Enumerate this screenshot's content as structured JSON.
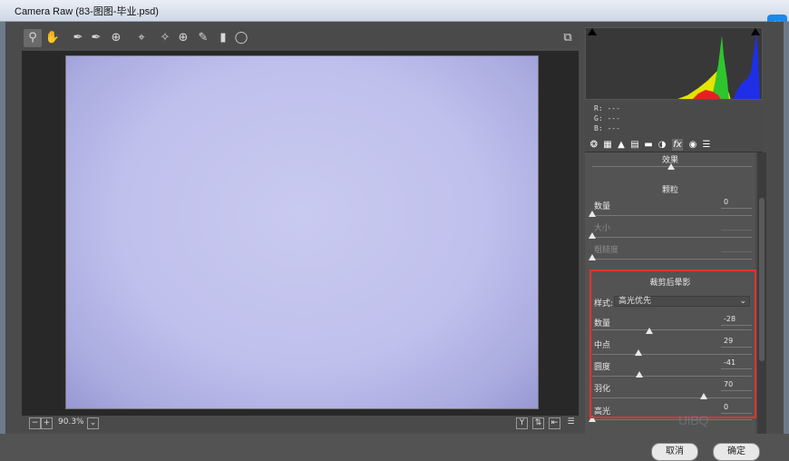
{
  "window": {
    "title": "Camera Raw (83-图图-毕业.psd)"
  },
  "toolbar": {
    "tools": [
      "zoom-icon",
      "hand-icon",
      "white-balance-icon",
      "color-sampler-icon",
      "targeted-adjust-icon",
      "crop-icon",
      "straighten-icon",
      "spot-removal-icon",
      "brush-icon",
      "graduated-filter-icon",
      "radial-filter-icon"
    ],
    "fullscreen_icon": "fullscreen-icon"
  },
  "status": {
    "zoom": "90.3%"
  },
  "rgb_readout": {
    "r": "R:  ---",
    "g": "G:  ---",
    "b": "B:  ---"
  },
  "effects_panel": {
    "top_label": "效果",
    "grain": {
      "title": "颗粒",
      "amount": {
        "label": "数量",
        "value": "0",
        "level": 0
      },
      "size": {
        "label": "大小",
        "value": "",
        "level": 0
      },
      "roughness": {
        "label": "粗糙度",
        "value": "",
        "level": 0
      }
    },
    "vignette": {
      "title": "裁剪后晕影",
      "style_label": "样式:",
      "style_value": "高光优先",
      "amount": {
        "label": "数量",
        "value": "-28",
        "level": 0.36
      },
      "midpoint": {
        "label": "中点",
        "value": "29",
        "level": 0.29
      },
      "roundness": {
        "label": "圆度",
        "value": "-41",
        "level": 0.295
      },
      "feather": {
        "label": "羽化",
        "value": "70",
        "level": 0.7
      },
      "highlights": {
        "label": "高光",
        "value": "0",
        "level": 0
      }
    }
  },
  "footer": {
    "cancel": "取消",
    "ok": "确定"
  },
  "watermark": "UiBQ"
}
